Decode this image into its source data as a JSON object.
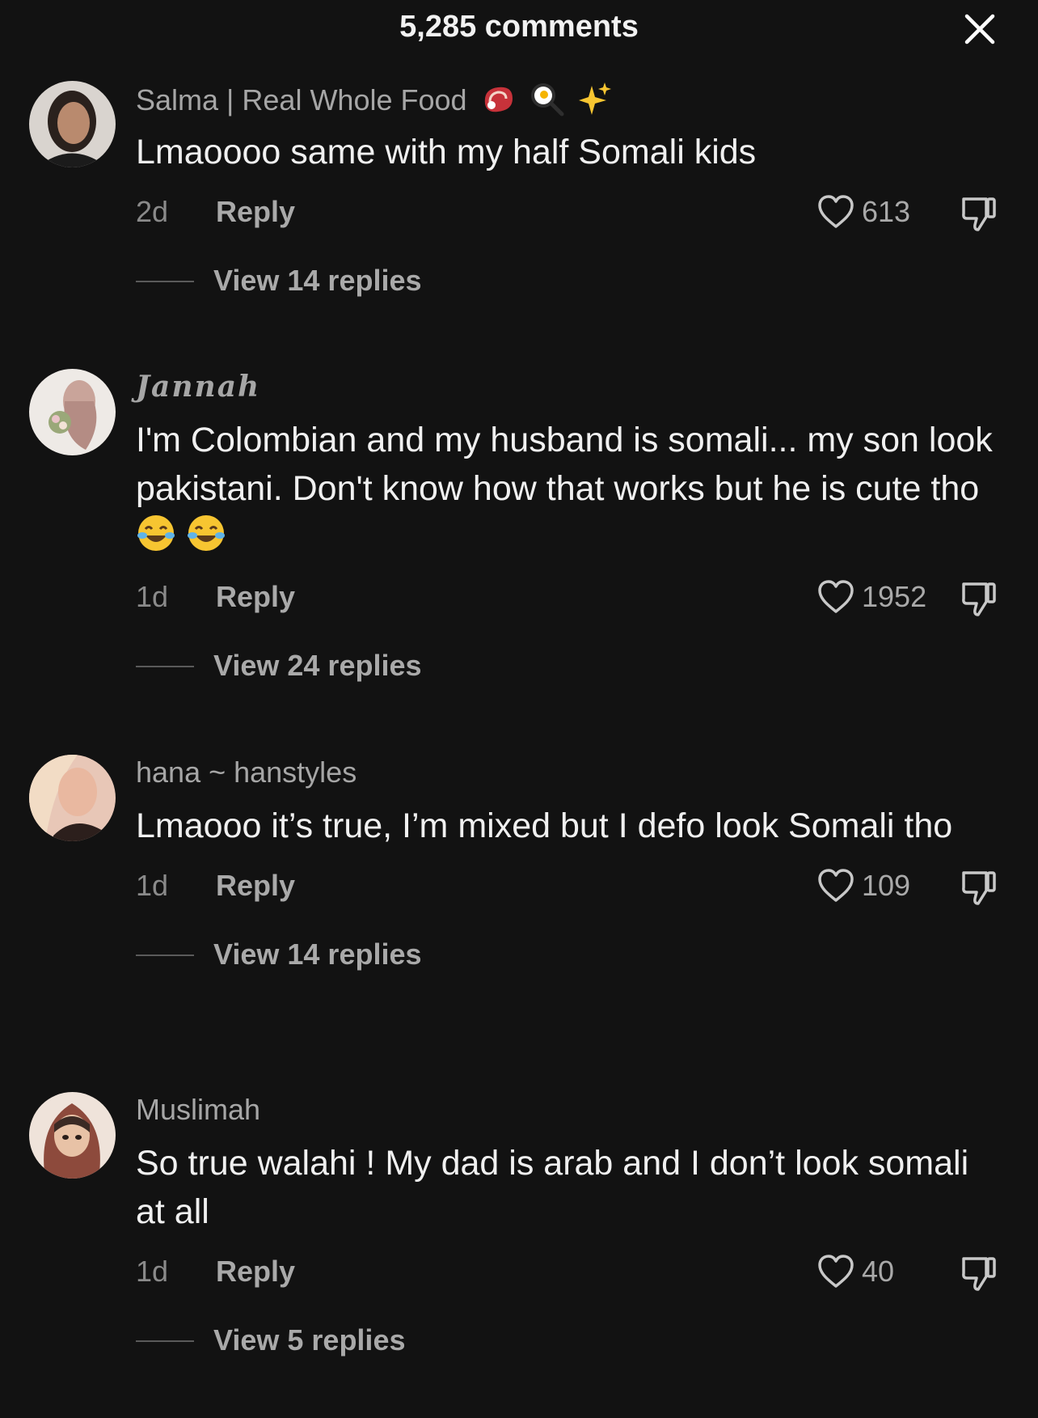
{
  "header": {
    "title": "5,285 comments"
  },
  "comments": [
    {
      "username": "Salma | Real Whole Food",
      "username_emojis": [
        "meat-emoji",
        "frying-pan-egg-emoji",
        "sparkles-emoji"
      ],
      "text": "Lmaoooo same with my half Somali kids",
      "time": "2d",
      "reply_label": "Reply",
      "likes": "613",
      "view_replies": "View 14 replies"
    },
    {
      "username": "Jannah",
      "text": "I'm Colombian and my husband is somali... my son look pakistani. Don't know how that works but he is cute tho",
      "text_emojis": [
        "tears-of-joy-emoji",
        "tears-of-joy-emoji"
      ],
      "time": "1d",
      "reply_label": "Reply",
      "likes": "1952",
      "view_replies": "View 24 replies"
    },
    {
      "username": "hana ~ hanstyles",
      "text": "Lmaooo it’s true, I’m mixed but I defo look Somali tho",
      "time": "1d",
      "reply_label": "Reply",
      "likes": "109",
      "view_replies": "View 14 replies"
    },
    {
      "username": "Muslimah",
      "text": "So true walahi ! My dad is arab and I don’t look somali at all",
      "time": "1d",
      "reply_label": "Reply",
      "likes": "40",
      "view_replies": "View 5 replies"
    }
  ],
  "colors": {
    "background": "#121212",
    "muted_text": "#a6a6a6",
    "primary_text": "#f0f0f0"
  }
}
